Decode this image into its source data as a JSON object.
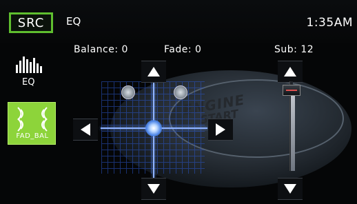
{
  "header": {
    "source_button_label": "SRC",
    "screen_title": "EQ",
    "clock": "1:35AM"
  },
  "readouts": {
    "balance": "Balance: 0",
    "fade": "Fade: 0",
    "sub": "Sub: 12"
  },
  "sidebar": {
    "eq_label": "EQ",
    "fad_bal_label": "FAD_BAL"
  },
  "background": {
    "engine": "ENGINE",
    "start": "START"
  },
  "sub_level": {
    "value": 12
  }
}
